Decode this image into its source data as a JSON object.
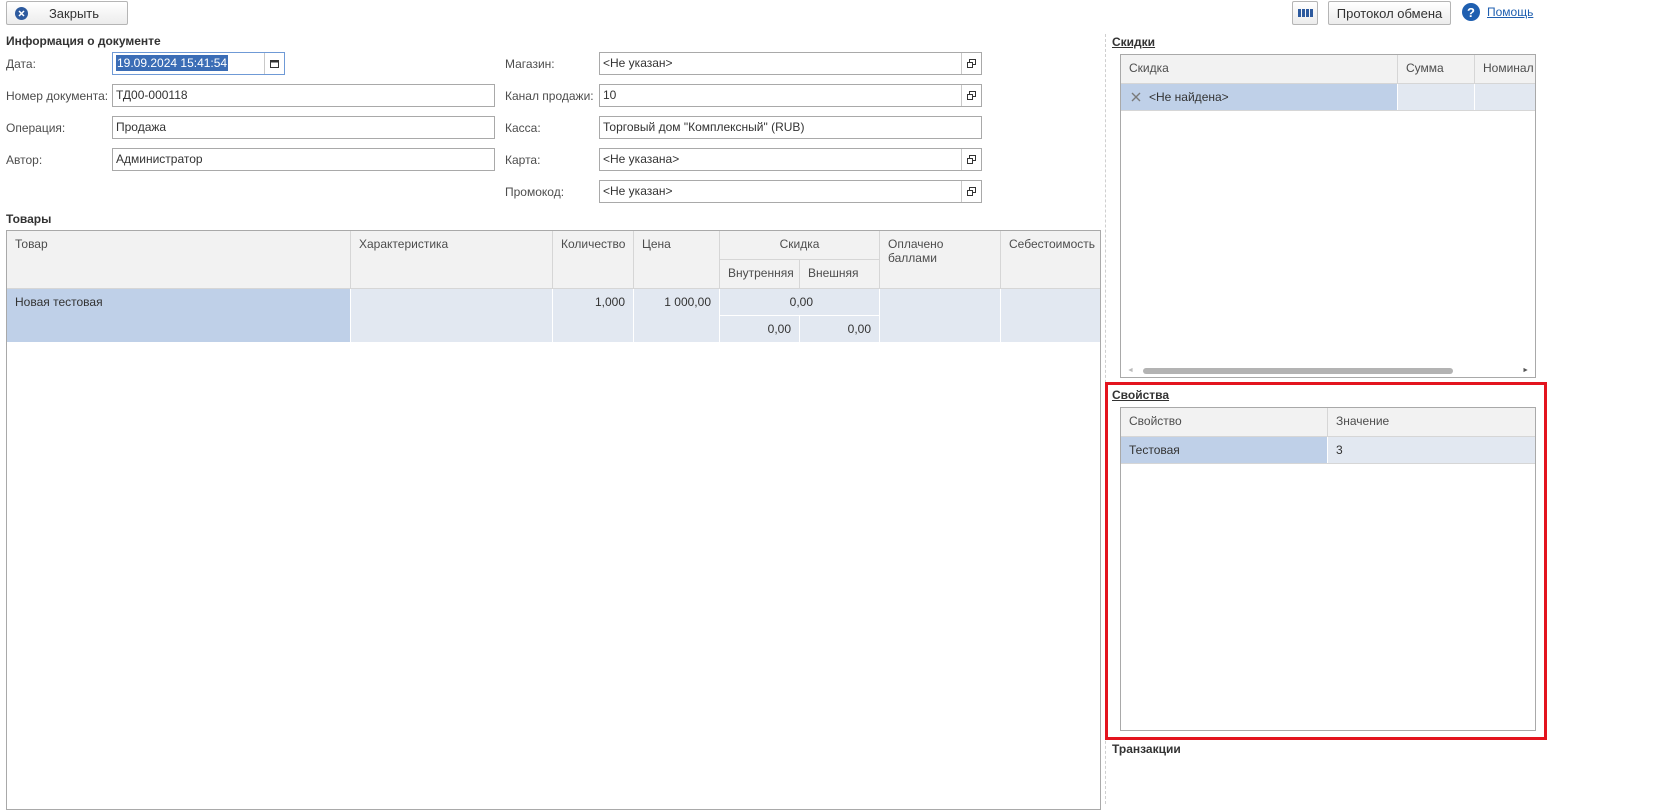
{
  "toolbar": {
    "close_label": "Закрыть",
    "exchange_log_label": "Протокол обмена",
    "help_label": "Помощь"
  },
  "doc_info": {
    "title": "Информация о документе",
    "date_label": "Дата:",
    "date_value": "19.09.2024 15:41:54",
    "number_label": "Номер документа:",
    "number_value": "ТД00-000118",
    "operation_label": "Операция:",
    "operation_value": "Продажа",
    "author_label": "Автор:",
    "author_value": "Администратор",
    "store_label": "Магазин:",
    "store_value": "<Не указан>",
    "channel_label": "Канал продажи:",
    "channel_value": "10",
    "cashbox_label": "Касса:",
    "cashbox_value": "Торговый дом \"Комплексный\" (RUB)",
    "card_label": "Карта:",
    "card_value": "<Не указана>",
    "promo_label": "Промокод:",
    "promo_value": "<Не указан>"
  },
  "goods": {
    "title": "Товары",
    "columns": {
      "item": "Товар",
      "characteristic": "Характеристика",
      "quantity": "Количество",
      "price": "Цена",
      "discount": "Скидка",
      "discount_internal": "Внутренняя",
      "discount_external": "Внешняя",
      "paid_points": "Оплачено баллами",
      "cost": "Себестоимость"
    },
    "rows": [
      {
        "item": "Новая тестовая",
        "characteristic": "",
        "quantity": "1,000",
        "price": "1 000,00",
        "discount": "0,00",
        "discount_internal": "0,00",
        "discount_external": "0,00",
        "paid_points": "",
        "cost": ""
      }
    ]
  },
  "discounts": {
    "title": "Скидки",
    "columns": {
      "discount": "Скидка",
      "sum": "Сумма",
      "nominal": "Номинал"
    },
    "rows": [
      {
        "discount": "<Не найдена>",
        "sum": "",
        "nominal": ""
      }
    ]
  },
  "properties": {
    "title": "Свойства",
    "columns": {
      "property": "Свойство",
      "value": "Значение"
    },
    "rows": [
      {
        "property": "Тестовая",
        "value": "3"
      }
    ]
  },
  "transactions": {
    "title": "Транзакции"
  },
  "colors": {
    "selection": "#bfd0e8",
    "row": "#e2e8f1",
    "highlight_frame": "#e3141e",
    "help_icon": "#1f5fb0",
    "close_icon": "#2d5a9e"
  }
}
